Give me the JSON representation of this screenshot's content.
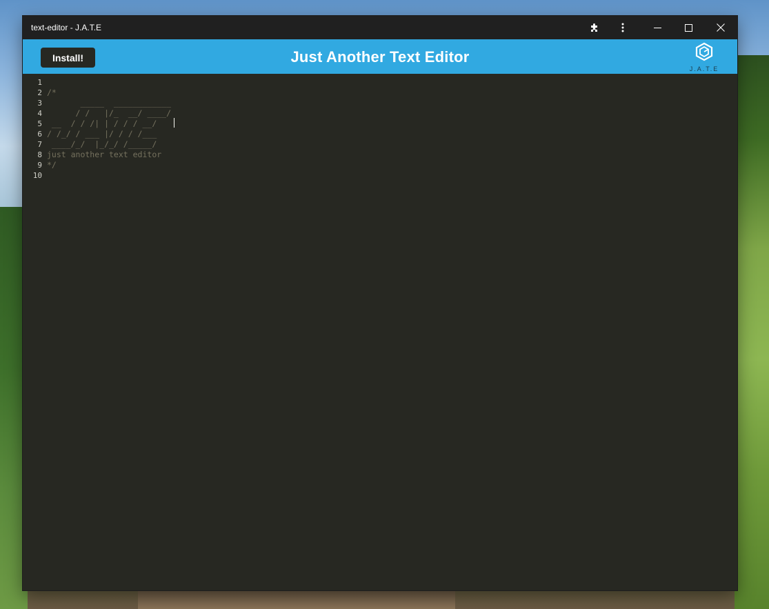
{
  "window": {
    "title": "text-editor - J.A.T.E",
    "controls": {
      "extensions_icon": "puzzle-icon",
      "menu_icon": "more-vert-icon",
      "minimize_icon": "minimize-icon",
      "maximize_icon": "maximize-icon",
      "close_icon": "close-icon"
    }
  },
  "app": {
    "install_label": "Install!",
    "title": "Just Another Text Editor",
    "logo_text": "J.A.T.E",
    "accent_color": "#31a9e1",
    "editor_bg": "#272822",
    "comment_color": "#75715e"
  },
  "editor": {
    "line_numbers": [
      "1",
      "2",
      "3",
      "4",
      "5",
      "6",
      "7",
      "8",
      "9",
      "10"
    ],
    "lines": [
      "",
      "/*",
      "       _____  ____________",
      "      / /   |/_  __/ ____/",
      " __  / / /| | / / / __/",
      "/ /_/ / ___ |/ / / /___",
      " ____/_/  |_/_/ /_____/",
      "just another text editor",
      "*/",
      ""
    ]
  }
}
